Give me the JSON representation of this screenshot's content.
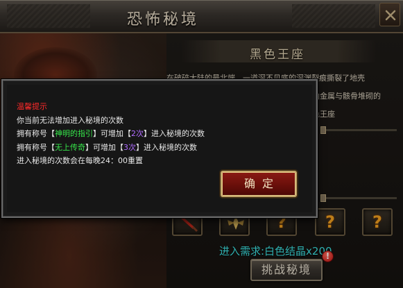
{
  "window": {
    "title": "恐怖秘境"
  },
  "dungeon": {
    "name": "黑色王座",
    "description_lines": [
      "在破碎大陆的最北端，一道深不见底的深渊裂痕撕裂了地壳",
      "曲金属与骸骨堆砌的",
      "色王座"
    ],
    "requirement": "进入需求:白色结晶x200",
    "challenge_label": "挑战秘境",
    "reward_slots": [
      {
        "icon": "red-blade-icon"
      },
      {
        "icon": "winged-emblem-icon"
      },
      {
        "icon": "question-icon",
        "text": "?"
      },
      {
        "icon": "question-icon",
        "text": "?"
      },
      {
        "icon": "question-icon",
        "text": "?"
      }
    ],
    "alert_mark": "!"
  },
  "dialog": {
    "title": "温馨提示",
    "line1": "你当前无法增加进入秘境的次数",
    "line2": {
      "prefix": "拥有称号【",
      "highlight": "神明的指引",
      "middle": "】可增加【",
      "count": "2次",
      "suffix": "】进入秘境的次数"
    },
    "line3": {
      "prefix": "拥有称号【",
      "highlight": "无上传奇",
      "middle": "】可增加【",
      "count": "3次",
      "suffix": "】进入秘境的次数"
    },
    "line4": "进入秘境的次数会在每晚24：00重置",
    "ok_label": "确定"
  },
  "colors": {
    "tip_title": "#ff2a2a",
    "title_highlight": "#36e64a",
    "count_highlight": "#b06cff",
    "requirement": "#3fe0e0"
  }
}
